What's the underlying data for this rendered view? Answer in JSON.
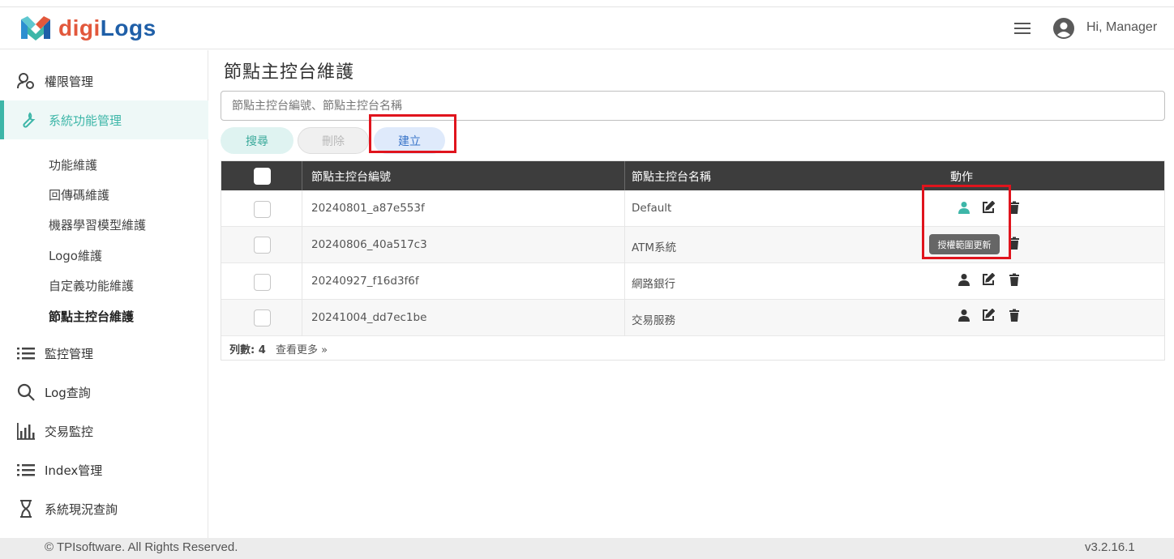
{
  "app": {
    "brand_part1": "digi",
    "brand_part2": "Logs",
    "greeting": "Hi, Manager",
    "colors": {
      "accent": "#3db6a8",
      "brand_orange": "#e2583c",
      "brand_blue": "#1f5fa8",
      "highlight": "#e0141d",
      "table_header": "#3d3d3d"
    }
  },
  "sidebar": {
    "items": [
      {
        "label": "權限管理",
        "icon": "permission-icon"
      },
      {
        "label": "系統功能管理",
        "icon": "wrench-icon",
        "active": true
      },
      {
        "label": "監控管理",
        "icon": "list-icon"
      },
      {
        "label": "Log查詢",
        "icon": "search-icon"
      },
      {
        "label": "交易監控",
        "icon": "bar-chart-icon"
      },
      {
        "label": "Index管理",
        "icon": "list-icon"
      },
      {
        "label": "系統現況查詢",
        "icon": "hourglass-icon"
      }
    ],
    "sub_items": [
      {
        "label": "功能維護"
      },
      {
        "label": "回傳碼維護"
      },
      {
        "label": "機器學習模型維護"
      },
      {
        "label": "Logo維護"
      },
      {
        "label": "自定義功能維護"
      },
      {
        "label": "節點主控台維護",
        "current": true
      }
    ]
  },
  "main": {
    "title": "節點主控台維護",
    "search_placeholder": "節點主控台編號、節點主控台名稱",
    "buttons": {
      "search": "搜尋",
      "delete": "刪除",
      "create": "建立"
    },
    "table": {
      "columns": [
        "節點主控台編號",
        "節點主控台名稱",
        "動作"
      ],
      "rows": [
        {
          "id": "20240801_a87e553f",
          "name": "Default"
        },
        {
          "id": "20240806_40a517c3",
          "name": "ATM系統"
        },
        {
          "id": "20240927_f16d3f6f",
          "name": "網路銀行"
        },
        {
          "id": "20241004_dd7ec1be",
          "name": "交易服務"
        }
      ],
      "row_count_label": "列數: 4",
      "more_label": "查看更多",
      "tooltip": "授權範圍更新"
    }
  },
  "footer": {
    "copyright": "© TPIsoftware. All Rights Reserved.",
    "version": "v3.2.16.1"
  }
}
